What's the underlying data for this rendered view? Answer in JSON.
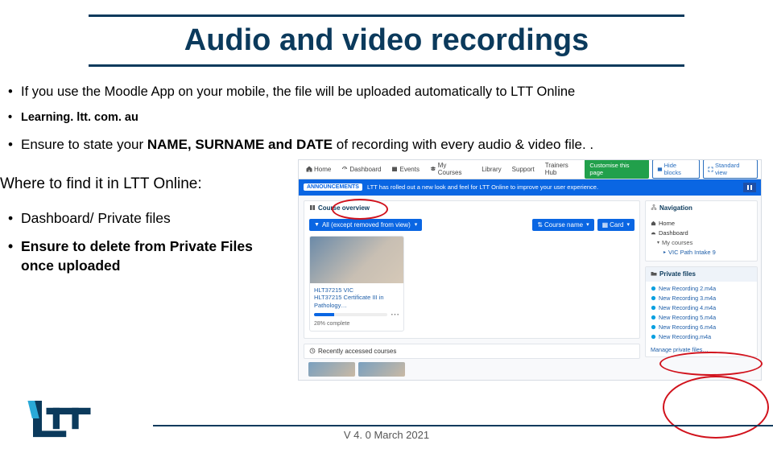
{
  "title": "Audio and video recordings",
  "bullets": {
    "b1": "If you use the Moodle App on your mobile, the file will be uploaded automatically to LTT Online",
    "b2": "Learning. ltt. com. au",
    "b3_pre": "Ensure to state your ",
    "b3_strong": "NAME, SURNAME and DATE",
    "b3_post": " of recording with every audio & video file. ."
  },
  "where_heading": "Where to find it in LTT Online:",
  "left_bullets": {
    "lb1": "Dashboard/ Private files",
    "lb2": "Ensure to delete from Private Files once uploaded"
  },
  "screenshot": {
    "nav": {
      "home": "Home",
      "dashboard": "Dashboard",
      "events": "Events",
      "mycourses": "My Courses",
      "library": "Library",
      "support": "Support",
      "trainers": "Trainers Hub"
    },
    "btn_customise": "Customise this page",
    "btn_hide": "Hide blocks",
    "btn_standard": "Standard view",
    "announce_tag": "ANNOUNCEMENTS",
    "announce_msg": "LTT has rolled out a new look and feel for LTT Online to improve your user experience.",
    "course_overview": "Course overview",
    "filter": "All (except removed from view)",
    "sort_name": "Course name",
    "sort_card": "Card",
    "card": {
      "code": "HLT37215 VIC",
      "name": "HLT37215 Certificate III in Pathology…",
      "progress": "28% complete"
    },
    "recent": "Recently accessed courses",
    "nav_panel": "Navigation",
    "tree": {
      "home": "Home",
      "dash": "Dashboard",
      "myc": "My courses",
      "course1": "VIC Path Intake 9"
    },
    "pf_title": "Private files",
    "files": {
      "f1": "New Recording 2.m4a",
      "f2": "New Recording 3.m4a",
      "f3": "New Recording 4.m4a",
      "f4": "New Recording 5.m4a",
      "f5": "New Recording 6.m4a",
      "f6": "New Recording.m4a"
    },
    "manage": "Manage private files…"
  },
  "version": "V 4. 0 March 2021"
}
